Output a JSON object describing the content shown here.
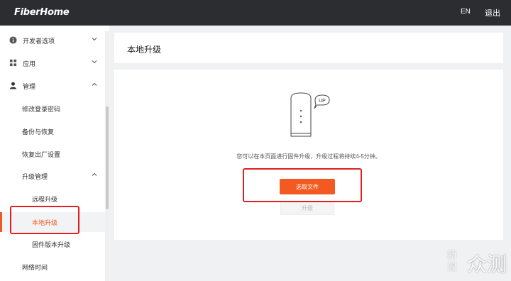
{
  "header": {
    "logo": "FiberHome",
    "lang": "EN",
    "logout": "退出"
  },
  "sidebar": {
    "items": [
      {
        "label": "开发者选项",
        "icon": "info-circle-icon",
        "expand": "chevron-down-icon"
      },
      {
        "label": "应用",
        "icon": "grid-icon",
        "expand": "chevron-down-icon"
      },
      {
        "label": "管理",
        "icon": "user-icon",
        "expand": "chevron-up-icon"
      },
      {
        "label": "修改登录密码"
      },
      {
        "label": "备份与恢复"
      },
      {
        "label": "恢复出厂设置"
      },
      {
        "label": "升级管理",
        "expand": "chevron-up-icon"
      },
      {
        "label": "远程升级"
      },
      {
        "label": "本地升级",
        "active": true
      },
      {
        "label": "固件版本升级"
      },
      {
        "label": "网络时间"
      }
    ]
  },
  "main": {
    "title": "本地升级",
    "bubble": "UP",
    "info": "您可以在本页面进行固件升级，升级过程将持续4-5分钟。",
    "select_file": "选取文件",
    "upgrade": "升级"
  },
  "watermark": {
    "small": "新浪",
    "big": "众测"
  },
  "colors": {
    "accent": "#f25a22",
    "header_bg": "#2b2d31",
    "highlight_box": "#e02020"
  }
}
